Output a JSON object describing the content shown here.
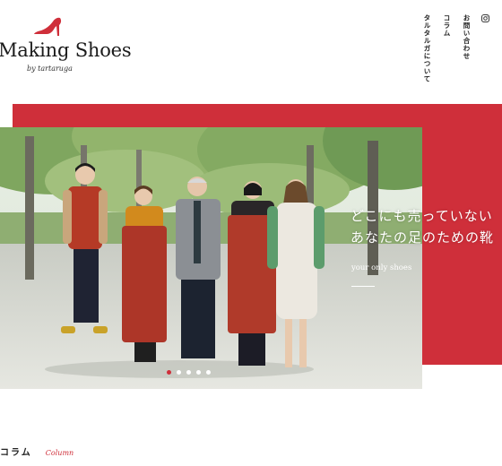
{
  "brand": {
    "title": "Making Shoes",
    "subtitle": "by tartaruga",
    "accent": "#cf2f3a"
  },
  "nav": {
    "items": [
      {
        "label": "お問い合わせ"
      },
      {
        "label": "コラム"
      },
      {
        "label": "タルタルガについて"
      }
    ],
    "instagram_icon": "instagram-icon"
  },
  "hero": {
    "catch_line1": "どこにも売っていない",
    "catch_line2": "あなたの足のための靴",
    "catch_sub": "your only shoes",
    "slide_count": 5,
    "active_slide": 1
  },
  "section": {
    "title_ja": "コラム",
    "title_en": "Column"
  }
}
